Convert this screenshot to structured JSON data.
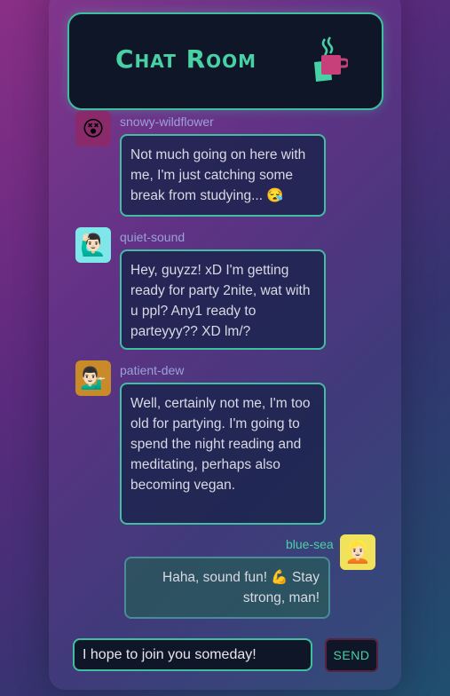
{
  "header": {
    "title": "Chat Room",
    "icon": "mug-icon"
  },
  "messages": [
    {
      "username": "snowy-wildflower",
      "avatar": "😵",
      "avatar_bg": "#8a2a6a",
      "text": "Not much going on here with me, I'm just catching some break from studying... 😪"
    },
    {
      "username": "quiet-sound",
      "avatar": "🙋🏻‍♂️",
      "avatar_bg": "#7fe6ea",
      "text": "Hey, guyzz! xD I'm getting ready for party 2nite, wat with u ppl? Any1 ready to parteyyy?? XD lm/?"
    },
    {
      "username": "patient-dew",
      "avatar": "💁🏻‍♂️",
      "avatar_bg": "#c98a2a",
      "text": "Well, certainly not me, I'm too old for partying. I'm going to spend the night reading and meditating, perhaps also becoming vegan."
    },
    {
      "username": "blue-sea",
      "avatar": "👱🏻",
      "avatar_bg": "#f0e25a",
      "text": "Haha, sound fun! 💪 Stay strong, man!",
      "own": true
    }
  ],
  "composer": {
    "value": "I hope to join you someday!",
    "send_label": "SEND"
  }
}
